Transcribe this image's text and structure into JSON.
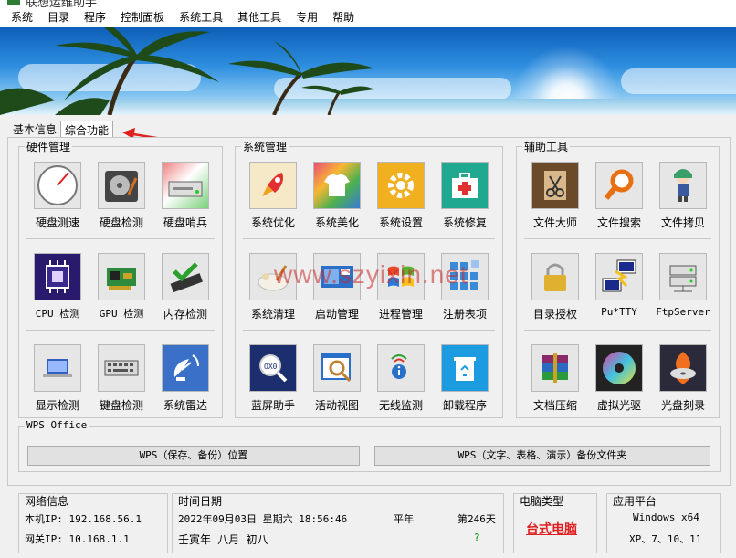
{
  "title": "联想运维助手",
  "menu": [
    "系统",
    "目录",
    "程序",
    "控制面板",
    "系统工具",
    "其他工具",
    "专用",
    "帮助"
  ],
  "tabs": [
    "基本信息",
    "综合功能"
  ],
  "groups": {
    "hardware": {
      "title": "硬件管理",
      "rows": [
        [
          {
            "label": "硬盘测速",
            "icon": "gauge-icon"
          },
          {
            "label": "硬盘检测",
            "icon": "hard-drive-icon"
          },
          {
            "label": "硬盘哨兵",
            "icon": "drive-sentinel-icon"
          }
        ],
        [
          {
            "label": "CPU 检测",
            "icon": "cpu-icon"
          },
          {
            "label": "GPU 检测",
            "icon": "gpu-card-icon"
          },
          {
            "label": "内存检测",
            "icon": "memory-check-icon"
          }
        ],
        [
          {
            "label": "显示检测",
            "icon": "laptop-display-icon"
          },
          {
            "label": "键盘检测",
            "icon": "keyboard-icon"
          },
          {
            "label": "系统雷达",
            "icon": "radar-dish-icon"
          }
        ]
      ]
    },
    "system": {
      "title": "系统管理",
      "rows": [
        [
          {
            "label": "系统优化",
            "icon": "rocket-icon"
          },
          {
            "label": "系统美化",
            "icon": "tshirt-icon"
          },
          {
            "label": "系统设置",
            "icon": "gear-icon"
          },
          {
            "label": "系统修复",
            "icon": "first-aid-kit-icon"
          }
        ],
        [
          {
            "label": "系统清理",
            "icon": "cleanup-icon"
          },
          {
            "label": "启动管理",
            "icon": "startup-icon"
          },
          {
            "label": "进程管理",
            "icon": "windows-flag-icon"
          },
          {
            "label": "注册表项",
            "icon": "registry-icon"
          }
        ],
        [
          {
            "label": "蓝屏助手",
            "icon": "bsod-magnifier-icon"
          },
          {
            "label": "活动视图",
            "icon": "activity-view-icon"
          },
          {
            "label": "无线监测",
            "icon": "wireless-info-icon"
          },
          {
            "label": "卸载程序",
            "icon": "recycle-bin-icon"
          }
        ]
      ]
    },
    "aux": {
      "title": "辅助工具",
      "rows": [
        [
          {
            "label": "文件大师",
            "icon": "scissors-icon"
          },
          {
            "label": "文件搜索",
            "icon": "search-icon"
          },
          {
            "label": "文件拷贝",
            "icon": "anime-character-icon"
          }
        ],
        [
          {
            "label": "目录授权",
            "icon": "padlock-icon"
          },
          {
            "label": "Pu*TTY",
            "icon": "putty-icon"
          },
          {
            "label": "FtpServer",
            "icon": "server-icon"
          }
        ],
        [
          {
            "label": "文档压缩",
            "icon": "winrar-books-icon"
          },
          {
            "label": "虚拟光驱",
            "icon": "optical-disc-icon"
          },
          {
            "label": "光盘刻录",
            "icon": "disc-burn-icon"
          }
        ]
      ]
    }
  },
  "wps": {
    "title": "WPS Office",
    "buttons": [
      "WPS（保存、备份）位置",
      "WPS（文字、表格、演示）备份文件夹"
    ]
  },
  "status": {
    "network": {
      "title": "网络信息",
      "local_ip": "本机IP: 192.168.56.1",
      "gateway_ip": "网关IP: 10.168.1.1"
    },
    "datetime": {
      "title": "时间日期",
      "datetime": "2022年09月03日 星期六 18:56:46",
      "year_type": "平年",
      "day_of_year": "第246天",
      "lunar": "壬寅年  八月  初八",
      "question": "?"
    },
    "pc_type": {
      "title": "电脑类型",
      "value": "台式电脑"
    },
    "platform": {
      "title": "应用平台",
      "line1": "Windows x64",
      "line2": "XP、7、10、11"
    }
  },
  "watermark": "www.szyixin.net",
  "colors": {
    "accent_red": "#e02020",
    "question_green": "#2ca02c"
  }
}
